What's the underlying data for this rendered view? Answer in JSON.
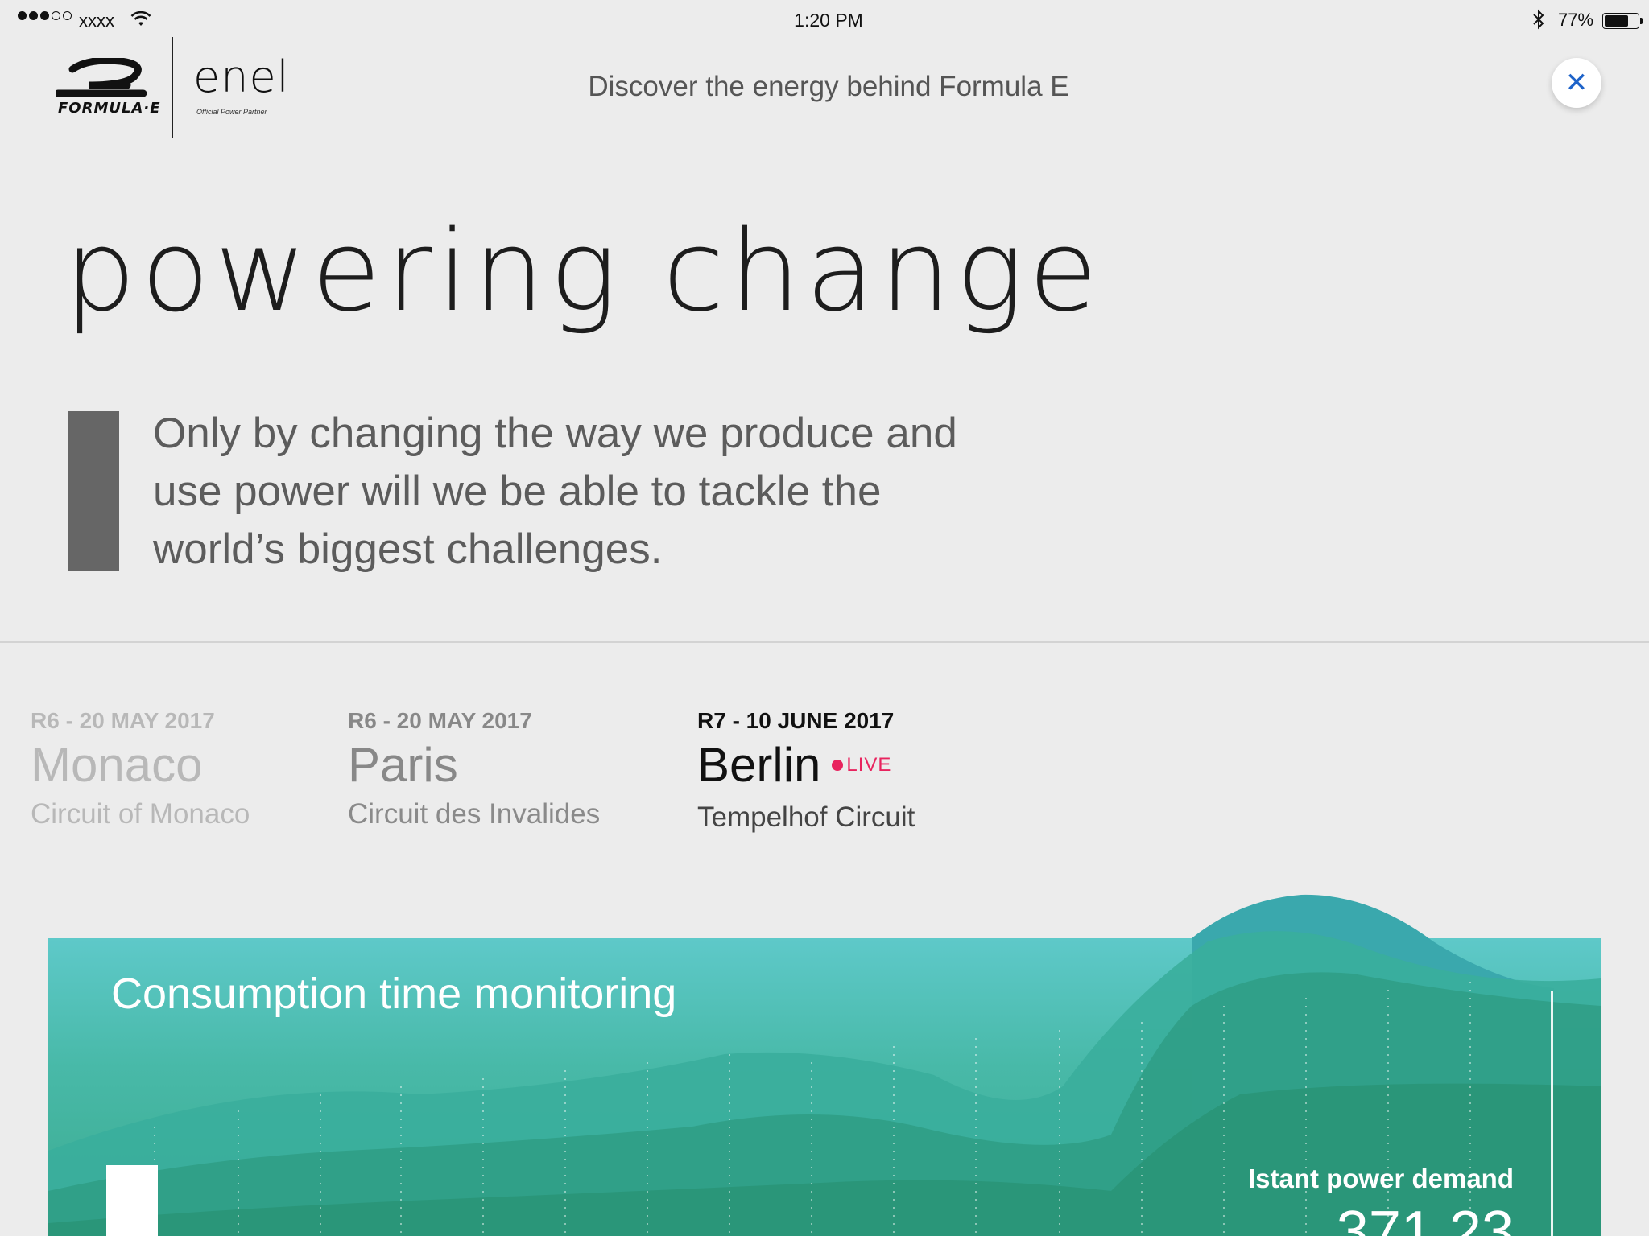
{
  "status_bar": {
    "carrier": "xxxx",
    "time": "1:20 PM",
    "battery_percent": "77%",
    "battery_level": 0.77
  },
  "header": {
    "formula_e_wordmark": "FORMULA·E",
    "enel_wordmark": "enel",
    "enel_subtitle": "Official Power Partner",
    "tagline": "Discover the energy behind Formula E",
    "close_icon": "close-icon"
  },
  "hero": {
    "title": "powering change",
    "quote": "Only by changing the way we produce and use power will we be able to tackle the world’s biggest challenges."
  },
  "races": [
    {
      "date": "R6 - 20 MAY 2017",
      "city": "Monaco",
      "circuit": "Circuit of Monaco",
      "live": false
    },
    {
      "date": "R6 - 20 MAY 2017",
      "city": "Paris",
      "circuit": "Circuit des Invalides",
      "live": false
    },
    {
      "date": "R7 - 10 JUNE 2017",
      "city": "Berlin",
      "circuit": "Tempelhof Circuit",
      "live": true,
      "live_label": "LIVE"
    }
  ],
  "monitoring": {
    "title": "Consumption time monitoring",
    "metric_label": "Istant power demand",
    "metric_value": "371.23"
  },
  "colors": {
    "accent_blue": "#1e63c9",
    "live_red": "#e8235e",
    "card_teal_top": "#5ec9c9",
    "card_green_bottom": "#3aa98c"
  }
}
